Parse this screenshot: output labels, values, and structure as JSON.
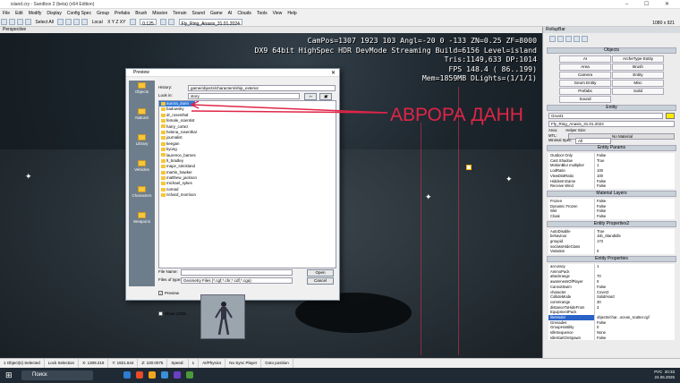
{
  "window": {
    "title": "island.cry - Sandbox 2 (beta) (x64 Edition)"
  },
  "menu": [
    "File",
    "Edit",
    "Modify",
    "Display",
    "Config Spec",
    "Group",
    "Prefabs",
    "Brush",
    "Mission",
    "Terrain",
    "Sound",
    "Game",
    "AI",
    "Clouds",
    "Tools",
    "View",
    "Help"
  ],
  "toolbar": {
    "select_all": "Select All",
    "coord_mode": "Local",
    "axes": "X Y Z XY",
    "snap": "0.125",
    "object_name": "Fly_Ring_Anasis_31.01.2024",
    "resolution": "1080 x 921"
  },
  "viewport": {
    "label": "Perspective",
    "stats": [
      "CamPos=1307 1923 103 Angl=-20  0 -133 ZN=0.25 ZF=8000",
      "DX9 64bit HighSpec HDR DevMode Streaming Build=6156 Level=island",
      "Tris:1149,633  DP:1014",
      "FPS 148.4 ( 86..199)",
      "Mem=1859MB DLights=(1/1/1)"
    ]
  },
  "annotation": {
    "text": "АВРОРА ДАНН",
    "color": "#e02548"
  },
  "dialog": {
    "title": "Preview",
    "history_label": "History:",
    "history_value": "game/objects/characters/ship_exterior",
    "lookin_label": "Look in:",
    "lookin_value": "story",
    "sidebar": [
      "Objects",
      "Natural",
      "Library",
      "Vehicles",
      "Characters",
      "Weapons"
    ],
    "files": [
      "aurora_dunn",
      "badowsky",
      "dr_rosenthal",
      "female_scientist",
      "harry_cortez",
      "helena_rosenthal",
      "journalist",
      "keegan",
      "kyong",
      "laurence_barnes",
      "lt_bradley",
      "major_strickland",
      "martin_hawker",
      "matthew_jackson",
      "michael_sykes",
      "nomad",
      "richard_morrison"
    ],
    "selected_file": "aurora_dunn",
    "filename_label": "File Name:",
    "filetype_label": "Files of type:",
    "filetype_value": "Geometry Files (*.cgf,*.chr,*.cdf,*.cga)",
    "open_label": "Open",
    "cancel_label": "Cancel",
    "preview_label": "Preview",
    "showlods_label": "Show LODs"
  },
  "panel": {
    "title": "RollupBar",
    "objects_header": "Objects",
    "objects_buttons": [
      "AI",
      "ArcheType Entity",
      "Area",
      "Brush",
      "Camera",
      "Entity",
      "Geom Entity",
      "Misc",
      "Prefabs",
      "Solid",
      "Sound"
    ],
    "entity_header": "Entity",
    "entity_name": "Grunt1",
    "entity_archetype": "Fly_Ring_Anasis_31.01.2024",
    "area_label": "Area:",
    "helper_label": "Helper Size:",
    "mtl_label": "MTL:",
    "nomaterial": "No Material",
    "minspec_label": "Minimal Spec:",
    "minspec_value": "All",
    "params_header": "Entity Params",
    "params": [
      [
        "Outdoor Only",
        "False"
      ],
      [
        "Cast Shadow",
        "True"
      ],
      [
        "MotionBlur multiplier",
        "1"
      ],
      [
        "LodRatio",
        "100"
      ],
      [
        "ViewDistRatio",
        "100"
      ],
      [
        "HiddenInGame",
        "False"
      ],
      [
        "Receive Wind",
        "False"
      ]
    ],
    "material_header": "Material Layers",
    "materials": [
      [
        "Frozen",
        "False"
      ],
      [
        "Dynamic Frozen",
        "False"
      ],
      [
        "Wet",
        "False"
      ],
      [
        "Cloak",
        "False"
      ]
    ],
    "props2_header": "Entity Properties2",
    "props2": [
      [
        "AutoDisable",
        "True"
      ],
      [
        "behaviour",
        "Job_StandIdle"
      ],
      [
        "groupid",
        "173"
      ],
      [
        "soclassHideClass",
        ""
      ],
      [
        "Variation",
        "0"
      ]
    ],
    "props_header": "Entity Properties",
    "props": [
      [
        "accuracy",
        "1"
      ],
      [
        "AmmoPack",
        ""
      ],
      [
        "attackrange",
        "70"
      ],
      [
        "awarenessOfPlayer",
        "0"
      ],
      [
        "CannotSwim",
        "False"
      ],
      [
        "character",
        "Cover2"
      ],
      [
        "CollideMode",
        "Solid/Hard"
      ],
      [
        "commrange",
        "30"
      ],
      [
        "distanceToHideFrom",
        "3"
      ],
      [
        "EquipmentPack",
        ""
      ],
      [
        "fileModel",
        "objects/char...ocean_scatter.cgf"
      ],
      [
        "Grenades",
        "False"
      ],
      [
        "GroupHostility",
        "0"
      ],
      [
        "IdleSequence",
        "None"
      ],
      [
        "IdleStartOnSpawn",
        "False"
      ]
    ]
  },
  "statusbar": [
    "1 Object(s) Selected",
    "Lock Selection",
    "X: 1309.219",
    "Y: 1921.644",
    "Z: 100.0075",
    "Speed:",
    "1",
    "AI/Physics",
    "No Sync Player",
    "Goto position"
  ],
  "taskbar": {
    "search": "Поиск",
    "lang": "РУС",
    "time": "20:33",
    "date": "24.06.2025"
  }
}
